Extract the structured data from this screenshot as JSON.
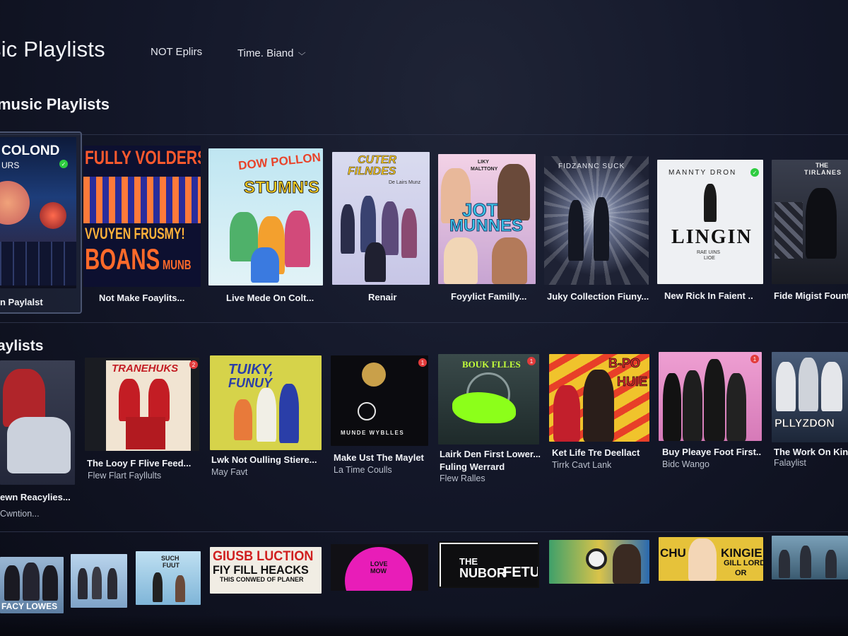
{
  "header": {
    "title": "sic Playlists",
    "filter_label": "NOT Eplirs",
    "sort_label": "Time. Biand"
  },
  "sections": [
    {
      "title": "music Playlists",
      "items": [
        {
          "caption": "n Paylalst",
          "art_lines": [
            "COLOND",
            "URS"
          ]
        },
        {
          "caption": "Not Make Foaylits...",
          "art_lines": [
            "FULLY VOLDERS",
            "VVUYEN FRUSMY!",
            "BOANS",
            "MUNB"
          ]
        },
        {
          "caption": "Live Mede On Colt...",
          "art_lines": [
            "DOW POLLON",
            "STUMN'S"
          ]
        },
        {
          "caption": "Renair",
          "art_lines": [
            "CUTER",
            "FILNDES",
            "De Lairs Munz"
          ]
        },
        {
          "caption": "Foyylict Familly...",
          "art_lines": [
            "LIKY",
            "MALTTONY",
            "JOT",
            "MUNNES"
          ]
        },
        {
          "caption": "Juky Collection Fiuny...",
          "art_lines": [
            "FIDZANNC SUCK"
          ]
        },
        {
          "caption": "New Rick In Faient ..",
          "art_lines": [
            "MANNTY DRON",
            "LINGIN",
            "RAE UINS",
            "LIOE"
          ]
        },
        {
          "caption": "Fide Migist Fount",
          "art_lines": [
            "THE",
            "TIRLANES"
          ]
        }
      ]
    },
    {
      "title": "aylists",
      "items": [
        {
          "caption": "ewn Reacylies...",
          "subtitle": "Cwntion...",
          "art_lines": []
        },
        {
          "caption": "The Looy F Flive Feed...",
          "subtitle": "Flew Flart Fayllults",
          "art_lines": [
            "TRANEHUKS"
          ]
        },
        {
          "caption": "Lwk Not Oulling Stiere...",
          "subtitle": "May Favt",
          "art_lines": [
            "TUIKY,",
            "FUNUY"
          ]
        },
        {
          "caption": "Make Ust The Maylet",
          "subtitle": "La Time Coulls",
          "art_lines": [
            "MUNDE WYBLLES"
          ]
        },
        {
          "caption": "Lairk Den First Lower...",
          "caption2": "Fuling Werrard",
          "subtitle": "Flew Ralles",
          "art_lines": [
            "BOUK FLLES"
          ]
        },
        {
          "caption": "Ket Life Tre Deellact",
          "subtitle": "Tirrk Cavt Lank",
          "art_lines": [
            "B-PO",
            "HUIE"
          ]
        },
        {
          "caption": "Buy Pleaye Foot First..",
          "subtitle": "Bidc Wango",
          "art_lines": []
        },
        {
          "caption": "The Work On Kinls",
          "subtitle": "Falaylist",
          "art_lines": [
            "PLLYZDON"
          ]
        }
      ]
    },
    {
      "title": "",
      "items": [
        {
          "art_lines": [
            "FACY LOWES"
          ]
        },
        {
          "art_lines": []
        },
        {
          "art_lines": [
            "SUCH",
            "FUUT"
          ]
        },
        {
          "art_lines": [
            "GIUSB LUCTION",
            "FIY FILL HEACKS",
            "THIS CONWED OF PLANER"
          ]
        },
        {
          "art_lines": [
            "LOVE",
            "MOW"
          ]
        },
        {
          "art_lines": [
            "THE",
            "NUBOR",
            "FETUM"
          ]
        },
        {
          "art_lines": []
        },
        {
          "art_lines": [
            "CHU",
            "KINGIE",
            "GILL LORD",
            "OR"
          ]
        },
        {
          "art_lines": []
        }
      ]
    }
  ],
  "colors": {
    "background": "#14182a",
    "focus_border": "#4a5470",
    "badge_red": "#e23b3b",
    "badge_green": "#2ecc40"
  },
  "icons": {
    "sort": "chevron-down-icon",
    "badge": "notification-badge-icon"
  }
}
